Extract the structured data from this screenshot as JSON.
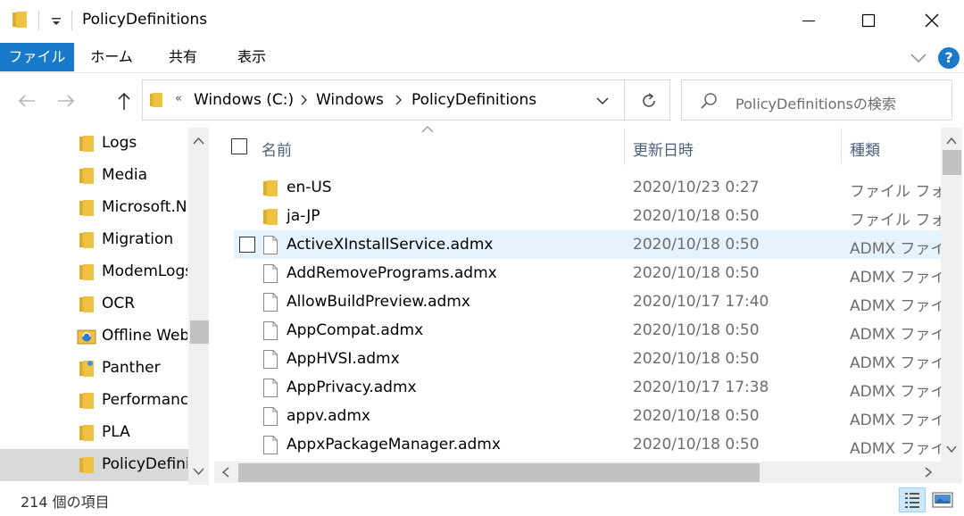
{
  "window": {
    "title": "PolicyDefinitions"
  },
  "ribbon": {
    "tabs": [
      "ファイル",
      "ホーム",
      "共有",
      "表示"
    ],
    "help_label": "?"
  },
  "address": {
    "overflow": "«",
    "crumbs": [
      "Windows (C:)",
      "Windows",
      "PolicyDefinitions"
    ]
  },
  "search": {
    "placeholder": "PolicyDefinitionsの検索"
  },
  "navpane": {
    "items": [
      {
        "label": "Logs",
        "icon": "folder-icon"
      },
      {
        "label": "Media",
        "icon": "folder-icon"
      },
      {
        "label": "Microsoft.NET",
        "icon": "folder-icon"
      },
      {
        "label": "Migration",
        "icon": "folder-icon"
      },
      {
        "label": "ModemLogs",
        "icon": "folder-icon"
      },
      {
        "label": "OCR",
        "icon": "folder-icon"
      },
      {
        "label": "Offline Web Pages",
        "icon": "offline-web-folder-icon"
      },
      {
        "label": "Panther",
        "icon": "panther-folder-icon"
      },
      {
        "label": "Performance",
        "icon": "folder-icon"
      },
      {
        "label": "PLA",
        "icon": "folder-icon"
      },
      {
        "label": "PolicyDefinitions",
        "icon": "folder-icon",
        "selected": true
      }
    ]
  },
  "columns": {
    "name": "名前",
    "date": "更新日時",
    "type": "種類"
  },
  "files": [
    {
      "name": "en-US",
      "date": "2020/10/23 0:27",
      "type": "ファイル フォルダー",
      "kind": "folder"
    },
    {
      "name": "ja-JP",
      "date": "2020/10/18 0:50",
      "type": "ファイル フォルダー",
      "kind": "folder"
    },
    {
      "name": "ActiveXInstallService.admx",
      "date": "2020/10/18 0:50",
      "type": "ADMX ファイル",
      "kind": "file",
      "hover": true
    },
    {
      "name": "AddRemovePrograms.admx",
      "date": "2020/10/18 0:50",
      "type": "ADMX ファイル",
      "kind": "file"
    },
    {
      "name": "AllowBuildPreview.admx",
      "date": "2020/10/17 17:40",
      "type": "ADMX ファイル",
      "kind": "file"
    },
    {
      "name": "AppCompat.admx",
      "date": "2020/10/18 0:50",
      "type": "ADMX ファイル",
      "kind": "file"
    },
    {
      "name": "AppHVSI.admx",
      "date": "2020/10/18 0:50",
      "type": "ADMX ファイル",
      "kind": "file"
    },
    {
      "name": "AppPrivacy.admx",
      "date": "2020/10/17 17:38",
      "type": "ADMX ファイル",
      "kind": "file"
    },
    {
      "name": "appv.admx",
      "date": "2020/10/18 0:50",
      "type": "ADMX ファイル",
      "kind": "file"
    },
    {
      "name": "AppxPackageManager.admx",
      "date": "2020/10/18 0:50",
      "type": "ADMX ファイル",
      "kind": "file"
    }
  ],
  "statusbar": {
    "item_count": "214 個の項目"
  },
  "colors": {
    "accent": "#1979ca",
    "hover_row": "#e5f3ff",
    "folder": "#f0c243"
  }
}
